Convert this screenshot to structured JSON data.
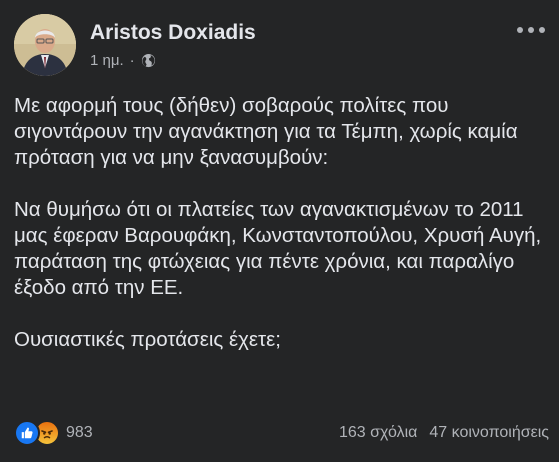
{
  "post": {
    "author": "Aristos Doxiadis",
    "time": "1 ημ.",
    "separator": "·",
    "privacy_icon": "globe-icon",
    "paragraphs": [
      "Με αφορμή τους (δήθεν) σοβαρούς πολίτες που σιγοντάρουν την αγανάκτηση για τα Τέμπη, χωρίς καμία πρόταση για να μην ξανασυμβούν:",
      "Να θυμήσω ότι οι πλατείες των αγανακτισμένων το 2011 μας έφεραν Βαρουφάκη, Κωνσταντοπούλου, Χρυσή Αυγή, παράταση της φτώχειας για πέντε χρόνια, και παραλίγο έξοδο από την ΕΕ.",
      "Ουσιαστικές προτάσεις έχετε;"
    ],
    "reactions": {
      "icons": [
        "like-icon",
        "angry-icon"
      ],
      "count": "983"
    },
    "comments": "163 σχόλια",
    "shares": "47 κοινοποιήσεις"
  },
  "colors": {
    "background": "#242526",
    "primary_text": "#e4e6eb",
    "secondary_text": "#b0b3b8",
    "like_blue": "#1877f2",
    "angry_orange": "#e9710f"
  }
}
